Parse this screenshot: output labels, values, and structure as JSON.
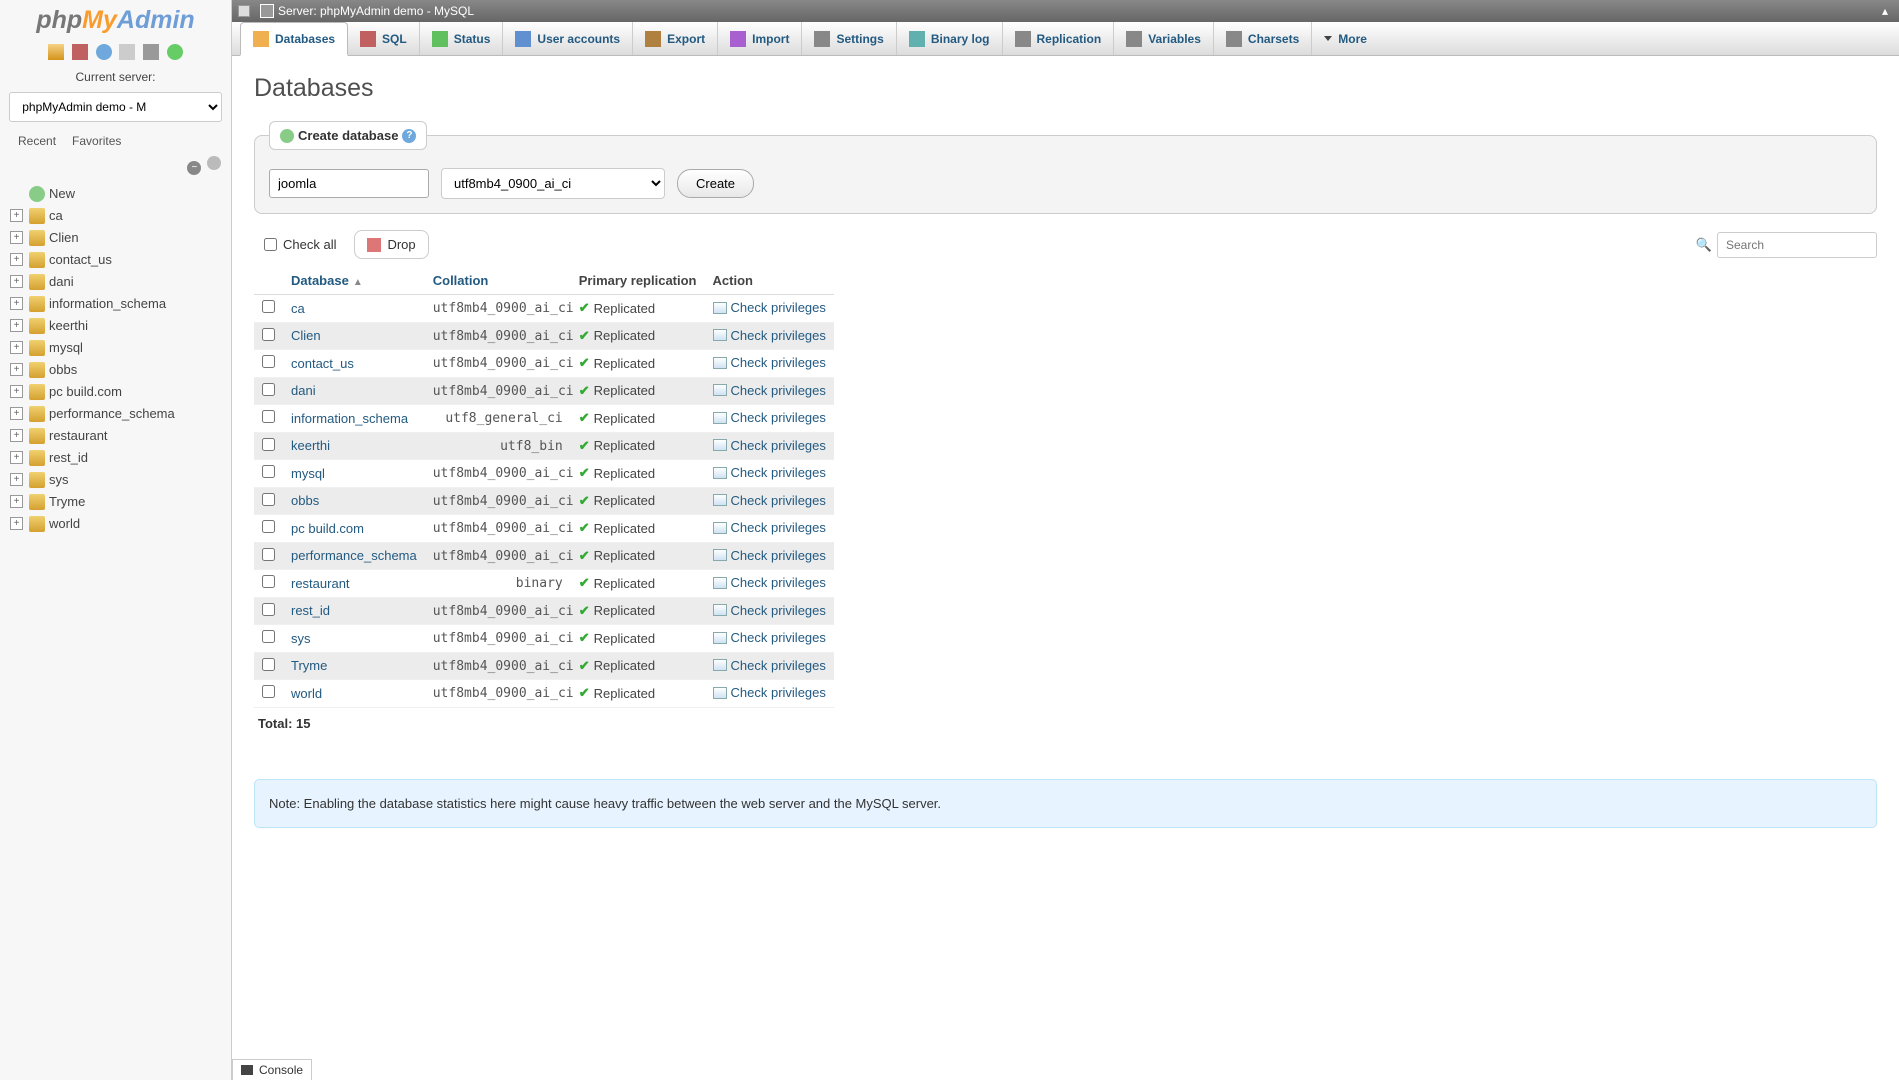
{
  "sidebar": {
    "current_server_label": "Current server:",
    "server_select_value": "phpMyAdmin demo - M",
    "recent_label": "Recent",
    "favorites_label": "Favorites",
    "new_label": "New",
    "items": [
      {
        "label": "ca"
      },
      {
        "label": "Clien"
      },
      {
        "label": "contact_us"
      },
      {
        "label": "dani"
      },
      {
        "label": "information_schema"
      },
      {
        "label": "keerthi"
      },
      {
        "label": "mysql"
      },
      {
        "label": "obbs"
      },
      {
        "label": "pc build.com"
      },
      {
        "label": "performance_schema"
      },
      {
        "label": "restaurant"
      },
      {
        "label": "rest_id"
      },
      {
        "label": "sys"
      },
      {
        "label": "Tryme"
      },
      {
        "label": "world"
      }
    ]
  },
  "topbar": {
    "server_label": "Server: phpMyAdmin demo - MySQL"
  },
  "menubar": {
    "items": [
      {
        "label": "Databases",
        "icon": "db",
        "active": true
      },
      {
        "label": "SQL",
        "icon": "sql"
      },
      {
        "label": "Status",
        "icon": "status"
      },
      {
        "label": "User accounts",
        "icon": "users"
      },
      {
        "label": "Export",
        "icon": "export"
      },
      {
        "label": "Import",
        "icon": "import"
      },
      {
        "label": "Settings",
        "icon": "settings"
      },
      {
        "label": "Binary log",
        "icon": "binlog"
      },
      {
        "label": "Replication",
        "icon": "repl"
      },
      {
        "label": "Variables",
        "icon": "vars"
      },
      {
        "label": "Charsets",
        "icon": "charsets"
      },
      {
        "label": "More",
        "icon": "more",
        "dropdown": true
      }
    ]
  },
  "page": {
    "title": "Databases",
    "create_legend": "Create database",
    "create_name_value": "joomla",
    "create_collation_value": "utf8mb4_0900_ai_ci",
    "create_button": "Create",
    "check_all_label": "Check all",
    "drop_label": "Drop",
    "search_placeholder": "Search",
    "columns": {
      "database": "Database",
      "collation": "Collation",
      "primary_replication": "Primary replication",
      "action": "Action"
    },
    "replicated_label": "Replicated",
    "check_privileges_label": "Check privileges",
    "rows": [
      {
        "name": "ca",
        "collation": "utf8mb4_0900_ai_ci"
      },
      {
        "name": "Clien",
        "collation": "utf8mb4_0900_ai_ci"
      },
      {
        "name": "contact_us",
        "collation": "utf8mb4_0900_ai_ci"
      },
      {
        "name": "dani",
        "collation": "utf8mb4_0900_ai_ci"
      },
      {
        "name": "information_schema",
        "collation": "utf8_general_ci"
      },
      {
        "name": "keerthi",
        "collation": "utf8_bin"
      },
      {
        "name": "mysql",
        "collation": "utf8mb4_0900_ai_ci"
      },
      {
        "name": "obbs",
        "collation": "utf8mb4_0900_ai_ci"
      },
      {
        "name": "pc build.com",
        "collation": "utf8mb4_0900_ai_ci"
      },
      {
        "name": "performance_schema",
        "collation": "utf8mb4_0900_ai_ci"
      },
      {
        "name": "restaurant",
        "collation": "binary"
      },
      {
        "name": "rest_id",
        "collation": "utf8mb4_0900_ai_ci"
      },
      {
        "name": "sys",
        "collation": "utf8mb4_0900_ai_ci"
      },
      {
        "name": "Tryme",
        "collation": "utf8mb4_0900_ai_ci"
      },
      {
        "name": "world",
        "collation": "utf8mb4_0900_ai_ci"
      }
    ],
    "total_label": "Total: 15",
    "note_text": "Note: Enabling the database statistics here might cause heavy traffic between the web server and the MySQL server.",
    "console_label": "Console"
  }
}
